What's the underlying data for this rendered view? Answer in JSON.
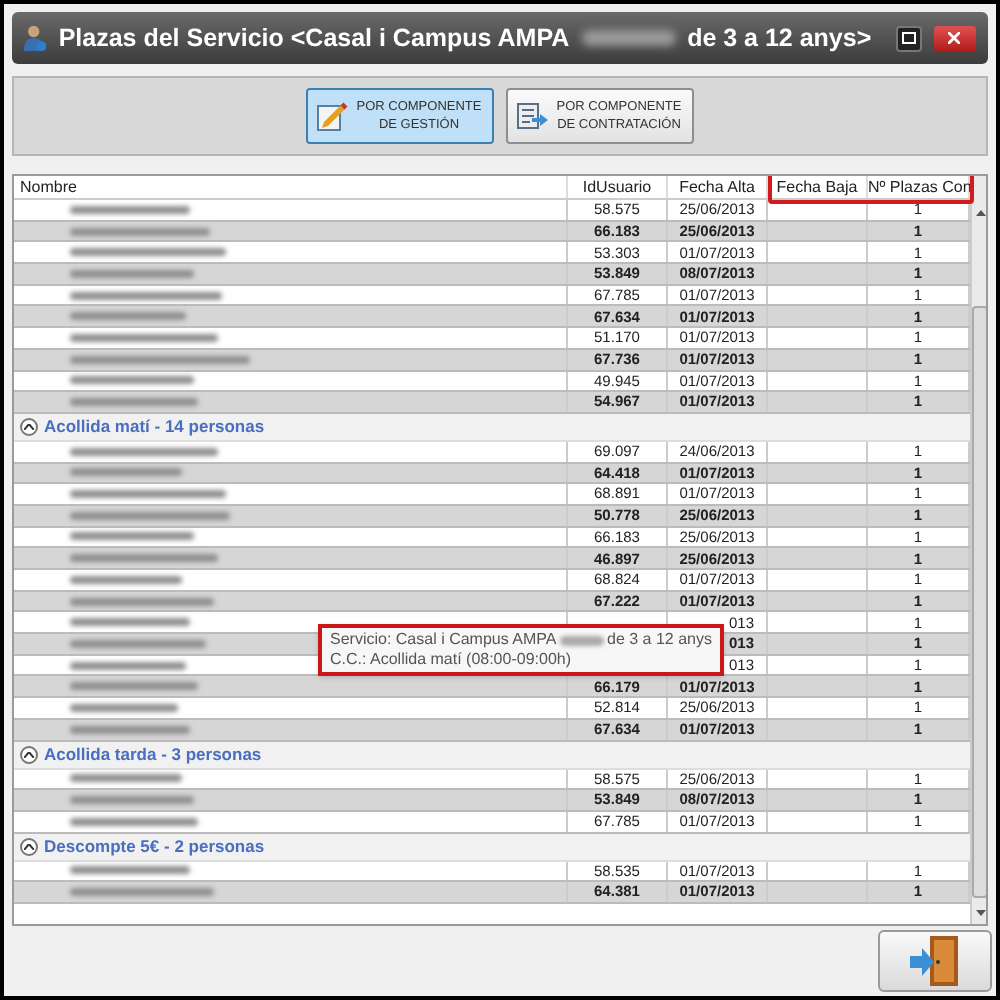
{
  "window": {
    "title_start": "Plazas del Servicio <Casal i Campus AMPA",
    "title_end": "de 3 a 12 anys>"
  },
  "toolbar": [
    {
      "label": "POR COMPONENTE DE GESTIÓN",
      "kind": "gestion",
      "selected": true
    },
    {
      "label": "POR COMPONENTE DE CONTRATACIÓN",
      "kind": "contratacion",
      "selected": false
    }
  ],
  "table": {
    "columns": [
      "Nombre",
      "IdUsuario",
      "Fecha Alta",
      "Fecha Baja",
      "Nº Plazas Con"
    ],
    "groups": [
      {
        "rows": [
          {
            "id": "58.575",
            "fecha_alta": "25/06/2013",
            "plazas": "1"
          },
          {
            "id": "66.183",
            "fecha_alta": "25/06/2013",
            "plazas": "1"
          },
          {
            "id": "53.303",
            "fecha_alta": "01/07/2013",
            "plazas": "1"
          },
          {
            "id": "53.849",
            "fecha_alta": "08/07/2013",
            "plazas": "1"
          },
          {
            "id": "67.785",
            "fecha_alta": "01/07/2013",
            "plazas": "1"
          },
          {
            "id": "67.634",
            "fecha_alta": "01/07/2013",
            "plazas": "1"
          },
          {
            "id": "51.170",
            "fecha_alta": "01/07/2013",
            "plazas": "1"
          },
          {
            "id": "67.736",
            "fecha_alta": "01/07/2013",
            "plazas": "1"
          },
          {
            "id": "49.945",
            "fecha_alta": "01/07/2013",
            "plazas": "1"
          },
          {
            "id": "54.967",
            "fecha_alta": "01/07/2013",
            "plazas": "1"
          }
        ]
      },
      {
        "title": "Acollida matí - 14 personas",
        "expanded": true,
        "rows": [
          {
            "id": "69.097",
            "fecha_alta": "24/06/2013",
            "plazas": "1"
          },
          {
            "id": "64.418",
            "fecha_alta": "01/07/2013",
            "plazas": "1"
          },
          {
            "id": "68.891",
            "fecha_alta": "01/07/2013",
            "plazas": "1"
          },
          {
            "id": "50.778",
            "fecha_alta": "25/06/2013",
            "plazas": "1"
          },
          {
            "id": "66.183",
            "fecha_alta": "25/06/2013",
            "plazas": "1"
          },
          {
            "id": "46.897",
            "fecha_alta": "25/06/2013",
            "plazas": "1"
          },
          {
            "id": "68.824",
            "fecha_alta": "01/07/2013",
            "plazas": "1"
          },
          {
            "id": "67.222",
            "fecha_alta": "01/07/2013",
            "plazas": "1"
          },
          {
            "fecha_alta": "013",
            "plazas": "1",
            "partial": true
          },
          {
            "fecha_alta": "013",
            "plazas": "1",
            "partial": true
          },
          {
            "fecha_alta": "013",
            "plazas": "1",
            "partial": true
          },
          {
            "id": "66.179",
            "fecha_alta": "01/07/2013",
            "plazas": "1"
          },
          {
            "id": "52.814",
            "fecha_alta": "25/06/2013",
            "plazas": "1"
          },
          {
            "id": "67.634",
            "fecha_alta": "01/07/2013",
            "plazas": "1"
          }
        ]
      },
      {
        "title": "Acollida tarda - 3 personas",
        "expanded": true,
        "rows": [
          {
            "id": "58.575",
            "fecha_alta": "25/06/2013",
            "plazas": "1"
          },
          {
            "id": "53.849",
            "fecha_alta": "08/07/2013",
            "plazas": "1"
          },
          {
            "id": "67.785",
            "fecha_alta": "01/07/2013",
            "plazas": "1"
          }
        ]
      },
      {
        "title": "Descompte 5€ - 2 personas",
        "expanded": true,
        "rows": [
          {
            "id": "58.535",
            "fecha_alta": "01/07/2013",
            "plazas": "1"
          },
          {
            "id": "64.381",
            "fecha_alta": "01/07/2013",
            "plazas": "1"
          }
        ]
      }
    ]
  },
  "tooltip": {
    "line1_start": "Servicio: Casal i Campus AMPA",
    "line1_end": "de 3 a 12 anys",
    "line2": "C.C.: Acollida matí (08:00-09:00h)"
  }
}
